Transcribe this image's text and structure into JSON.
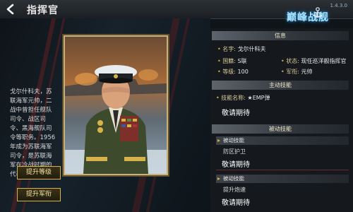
{
  "header": {
    "title": "指挥官",
    "game_logo": "巅峰战舰",
    "version_text": "1.4.3.0"
  },
  "biography": "戈尔什科夫，苏联海军元帅，二战中曾担任舰队司令、战区司令、黑海舰队司令等职务。1956年成为苏联海军司令，是苏联海军在冷战时期的代表人物之一。",
  "buttons": {
    "level_up": "提升等级",
    "rank_up": "提升军衔"
  },
  "info": {
    "heading": "信息",
    "name_label": "名字:",
    "name": "戈尔什科夫",
    "nation_label": "国籍:",
    "nation": "S联",
    "status_label": "状态:",
    "status": "现任巡洋舰指挥官",
    "level_label": "等级:",
    "level": "100",
    "rank_label": "军衔:",
    "rank": "元帅"
  },
  "active_skill": {
    "heading": "主动技能",
    "name_label": "技能名称:",
    "name": "★EMP弹",
    "desc": "敬请期待"
  },
  "passive_skills": {
    "heading": "被动技能",
    "items": [
      {
        "header": "被动技能",
        "name": "防区护卫",
        "desc": "敬请期待"
      },
      {
        "header": "被动技能",
        "name": "提升炮速",
        "desc": "敬请期待"
      }
    ]
  },
  "colors": {
    "accent_gold": "#d6b24a",
    "panel_bg": "#161a1e"
  }
}
